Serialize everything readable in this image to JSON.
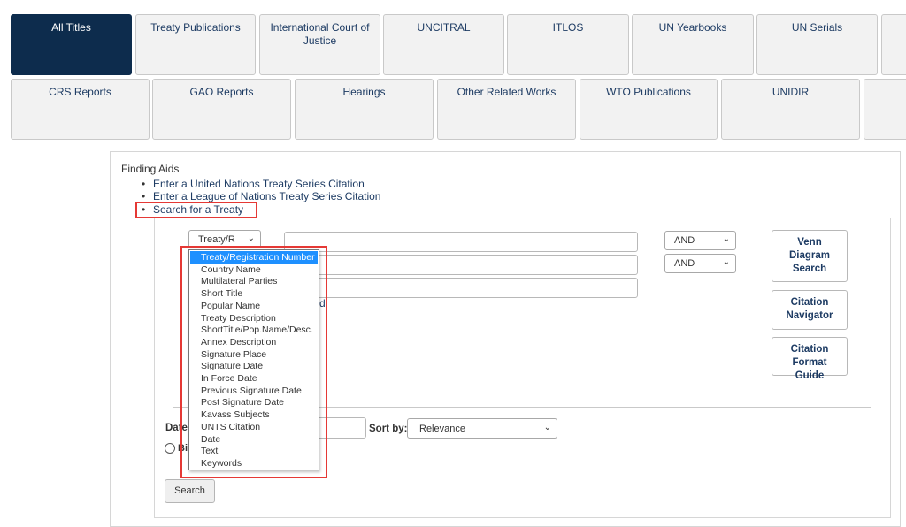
{
  "tabs_row1": [
    {
      "label": "All Titles",
      "active": true
    },
    {
      "label": "Treaty Publications"
    },
    {
      "label": "International Court of Justice"
    },
    {
      "label": "UNCITRAL"
    },
    {
      "label": "ITLOS"
    },
    {
      "label": "UN Yearbooks"
    },
    {
      "label": "UN Serials"
    }
  ],
  "tabs_row2": [
    {
      "label": "CRS Reports"
    },
    {
      "label": "GAO Reports"
    },
    {
      "label": "Hearings"
    },
    {
      "label": "Other Related Works"
    },
    {
      "label": "WTO Publications"
    },
    {
      "label": "UNIDIR"
    }
  ],
  "finding_aids": {
    "title": "Finding Aids",
    "items": [
      "Enter a United Nations Treaty Series Citation",
      "Enter a League of Nations Treaty Series Citation",
      "Search for a Treaty"
    ]
  },
  "search": {
    "field_select_value": "Treaty/R",
    "operators": [
      "AND",
      "AND"
    ],
    "link_fragment": "d",
    "date_label": "Date:",
    "sort_label": "Sort by:",
    "sort_value": "Relevance",
    "radio_label": "Bi",
    "search_button": "Search"
  },
  "field_options": [
    "Treaty/Registration Number",
    "Country Name",
    "Multilateral Parties",
    "Short Title",
    "Popular Name",
    "Treaty Description",
    "ShortTitle/Pop.Name/Desc.",
    "Annex Description",
    "Signature Place",
    "Signature Date",
    "In Force Date",
    "Previous Signature Date",
    "Post Signature Date",
    "Kavass Subjects",
    "UNTS Citation",
    "Date",
    "Text",
    "Keywords"
  ],
  "side_buttons": {
    "venn": "Venn Diagram Search",
    "citation_navigator": "Citation Navigator",
    "citation_format": "Citation Format Guide"
  },
  "colors": {
    "active_tab": "#0d2c4d",
    "link": "#1d3b63",
    "highlight": "#e53935",
    "selected_option": "#1e90ff"
  }
}
